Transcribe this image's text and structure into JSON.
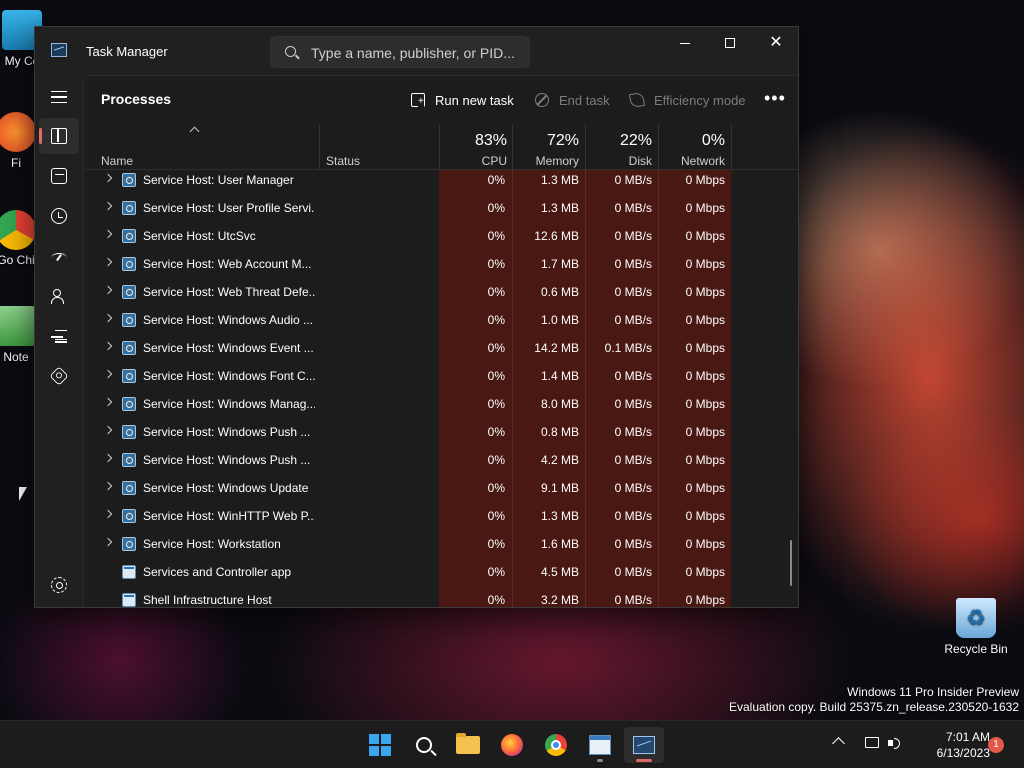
{
  "desktop": {
    "icons": [
      {
        "label": "My Co"
      },
      {
        "label": "Fi"
      },
      {
        "label": "Go Chi"
      },
      {
        "label": "Note"
      },
      {
        "label": "Recycle Bin"
      }
    ],
    "watermark": {
      "line1": "Windows 11 Pro Insider Preview",
      "line2": "Evaluation copy. Build 25375.zn_release.230520-1632"
    }
  },
  "window": {
    "title": "Task Manager",
    "search": {
      "placeholder": "Type a name, publisher, or PID...",
      "value": ""
    },
    "controls": {
      "minimize": "minimize",
      "maximize": "maximize",
      "close": "✕"
    }
  },
  "nav": {
    "items": [
      {
        "icon": "hamburger-menu-icon"
      },
      {
        "icon": "processes-icon",
        "active": true
      },
      {
        "icon": "performance-icon"
      },
      {
        "icon": "app-history-icon"
      },
      {
        "icon": "startup-apps-icon"
      },
      {
        "icon": "users-icon"
      },
      {
        "icon": "details-icon"
      },
      {
        "icon": "services-icon"
      }
    ],
    "settings_icon": "settings-icon"
  },
  "toolbar": {
    "title": "Processes",
    "run_new_task": "Run new task",
    "end_task": "End task",
    "efficiency_mode": "Efficiency mode",
    "more": "•••"
  },
  "table": {
    "columns": {
      "name": "Name",
      "status": "Status",
      "cpu": {
        "pct": "83%",
        "label": "CPU"
      },
      "memory": {
        "pct": "72%",
        "label": "Memory"
      },
      "disk": {
        "pct": "22%",
        "label": "Disk"
      },
      "network": {
        "pct": "0%",
        "label": "Network"
      }
    },
    "rows": [
      {
        "name": "Service Host: User Manager",
        "expandable": true,
        "cpu": "0%",
        "memory": "1.3 MB",
        "disk": "0 MB/s",
        "network": "0 Mbps"
      },
      {
        "name": "Service Host: User Profile Servi...",
        "expandable": true,
        "cpu": "0%",
        "memory": "1.3 MB",
        "disk": "0 MB/s",
        "network": "0 Mbps"
      },
      {
        "name": "Service Host: UtcSvc",
        "expandable": true,
        "cpu": "0%",
        "memory": "12.6 MB",
        "disk": "0 MB/s",
        "network": "0 Mbps"
      },
      {
        "name": "Service Host: Web Account M...",
        "expandable": true,
        "cpu": "0%",
        "memory": "1.7 MB",
        "disk": "0 MB/s",
        "network": "0 Mbps"
      },
      {
        "name": "Service Host: Web Threat Defe...",
        "expandable": true,
        "cpu": "0%",
        "memory": "0.6 MB",
        "disk": "0 MB/s",
        "network": "0 Mbps"
      },
      {
        "name": "Service Host: Windows Audio ...",
        "expandable": true,
        "cpu": "0%",
        "memory": "1.0 MB",
        "disk": "0 MB/s",
        "network": "0 Mbps"
      },
      {
        "name": "Service Host: Windows Event ...",
        "expandable": true,
        "cpu": "0%",
        "memory": "14.2 MB",
        "disk": "0.1 MB/s",
        "network": "0 Mbps"
      },
      {
        "name": "Service Host: Windows Font C...",
        "expandable": true,
        "cpu": "0%",
        "memory": "1.4 MB",
        "disk": "0 MB/s",
        "network": "0 Mbps"
      },
      {
        "name": "Service Host: Windows Manag...",
        "expandable": true,
        "cpu": "0%",
        "memory": "8.0 MB",
        "disk": "0 MB/s",
        "network": "0 Mbps"
      },
      {
        "name": "Service Host: Windows Push ...",
        "expandable": true,
        "cpu": "0%",
        "memory": "0.8 MB",
        "disk": "0 MB/s",
        "network": "0 Mbps"
      },
      {
        "name": "Service Host: Windows Push ...",
        "expandable": true,
        "cpu": "0%",
        "memory": "4.2 MB",
        "disk": "0 MB/s",
        "network": "0 Mbps"
      },
      {
        "name": "Service Host: Windows Update",
        "expandable": true,
        "cpu": "0%",
        "memory": "9.1 MB",
        "disk": "0 MB/s",
        "network": "0 Mbps"
      },
      {
        "name": "Service Host: WinHTTP Web P...",
        "expandable": true,
        "cpu": "0%",
        "memory": "1.3 MB",
        "disk": "0 MB/s",
        "network": "0 Mbps"
      },
      {
        "name": "Service Host: Workstation",
        "expandable": true,
        "cpu": "0%",
        "memory": "1.6 MB",
        "disk": "0 MB/s",
        "network": "0 Mbps"
      },
      {
        "name": "Services and Controller app",
        "expandable": false,
        "cpu": "0%",
        "memory": "4.5 MB",
        "disk": "0 MB/s",
        "network": "0 Mbps"
      },
      {
        "name": "Shell Infrastructure Host",
        "expandable": false,
        "cpu": "0%",
        "memory": "3.2 MB",
        "disk": "0 MB/s",
        "network": "0 Mbps"
      }
    ]
  },
  "taskbar": {
    "apps": [
      {
        "icon": "start-icon"
      },
      {
        "icon": "search-icon"
      },
      {
        "icon": "file-explorer-icon"
      },
      {
        "icon": "firefox-icon"
      },
      {
        "icon": "chrome-icon"
      },
      {
        "icon": "notepad-icon",
        "running": true
      },
      {
        "icon": "task-manager-icon",
        "active": true
      }
    ],
    "clock": {
      "time": "7:01 AM",
      "date": "6/13/2023"
    },
    "notification_count": "1"
  },
  "colors": {
    "accent": "#e06a6a",
    "cpu_band": "#4a1812",
    "window_bg": "#202020"
  }
}
